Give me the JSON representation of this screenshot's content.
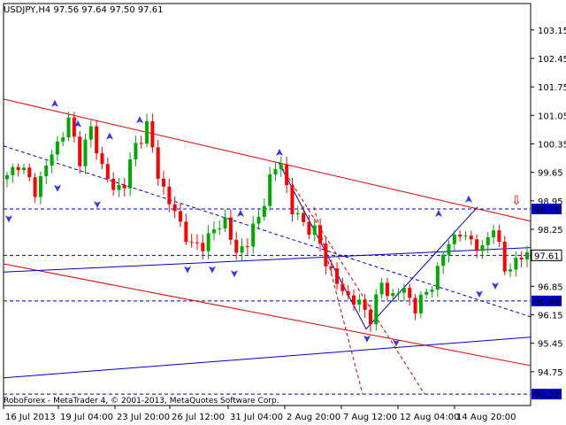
{
  "chart_window": {
    "title": "USDJPY,H4  97.56 97.64 97.50 97.61",
    "copyright": "RoboForex - MetaTrader 4, © 2001-2013, MetaQuotes Software Corp."
  },
  "colors": {
    "bull_candle": "#00aa00",
    "bear_candle": "#ff0000",
    "channel_red": "#dd0000",
    "line_blue": "#0000cc",
    "fractal_arrow": "#3333ff",
    "price_tag_bg": "#0000cc",
    "background": "#ffffff"
  },
  "chart_data": {
    "type": "candlestick",
    "symbol": "USDJPY",
    "timeframe": "H4",
    "ohlc_header": {
      "open": 97.56,
      "high": 97.64,
      "low": 97.5,
      "close": 97.61
    },
    "y_axis": {
      "ticks": [
        "103.15",
        "102.45",
        "101.75",
        "101.05",
        "100.35",
        "99.65",
        "98.95",
        "98.25",
        "97.55",
        "96.85",
        "96.15",
        "95.45",
        "94.75"
      ],
      "tagged_levels": [
        {
          "label": "98.75",
          "value": 98.75
        },
        {
          "label": "97.61",
          "value": 97.61
        },
        {
          "label": "96.49",
          "value": 96.49
        },
        {
          "label": "94.20",
          "value": 94.2
        }
      ],
      "range": [
        94.05,
        103.45
      ]
    },
    "x_axis": {
      "ticks": [
        "16 Jul 2013",
        "19 Jul 04:00",
        "23 Jul 20:00",
        "26 Jul 12:00",
        "31 Jul 04:00",
        "2 Aug 20:00",
        "7 Aug 12:00",
        "12 Aug 04:00",
        "14 Aug 20:00"
      ]
    },
    "price_path": [
      [
        0,
        99.5
      ],
      [
        2,
        99.9
      ],
      [
        5,
        99.2
      ],
      [
        8,
        100.1
      ],
      [
        11,
        100.9
      ],
      [
        13,
        100.0
      ],
      [
        15,
        100.7
      ],
      [
        17,
        99.8
      ],
      [
        19,
        99.2
      ],
      [
        21,
        99.4
      ],
      [
        23,
        100.3
      ],
      [
        25,
        100.8
      ],
      [
        27,
        99.6
      ],
      [
        29,
        98.9
      ],
      [
        31,
        98.4
      ],
      [
        33,
        97.8
      ],
      [
        35,
        97.9
      ],
      [
        37,
        98.2
      ],
      [
        39,
        98.5
      ],
      [
        41,
        97.6
      ],
      [
        43,
        98.0
      ],
      [
        45,
        98.5
      ],
      [
        47,
        99.5
      ],
      [
        49,
        99.9
      ],
      [
        51,
        98.7
      ],
      [
        53,
        98.4
      ],
      [
        55,
        98.2
      ],
      [
        57,
        97.5
      ],
      [
        59,
        96.9
      ],
      [
        61,
        96.6
      ],
      [
        63,
        96.4
      ],
      [
        65,
        96.1
      ],
      [
        67,
        96.9
      ],
      [
        69,
        96.6
      ],
      [
        71,
        96.8
      ],
      [
        73,
        96.3
      ],
      [
        75,
        96.7
      ],
      [
        77,
        97.2
      ],
      [
        79,
        98.0
      ],
      [
        81,
        98.1
      ],
      [
        83,
        98.0
      ],
      [
        85,
        97.7
      ],
      [
        87,
        98.4
      ],
      [
        89,
        97.2
      ],
      [
        91,
        97.5
      ],
      [
        93,
        97.61
      ]
    ],
    "levels": [
      98.75,
      97.61,
      96.49,
      94.2
    ],
    "markers": [
      {
        "type": "down-arrow",
        "value": 98.95,
        "label": "⇩"
      }
    ]
  }
}
